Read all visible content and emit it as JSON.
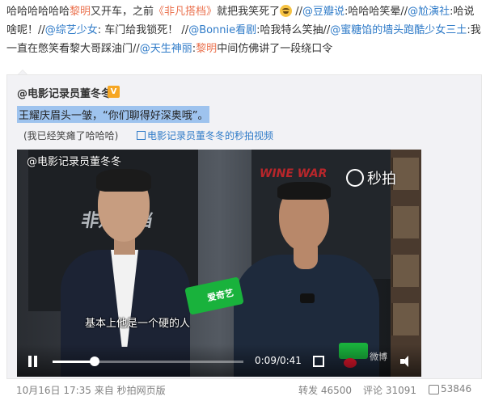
{
  "post": {
    "seg1": "哈哈哈哈哈哈",
    "name1": "黎明",
    "seg2": "又开车，之前",
    "topic": "《非凡搭档》",
    "seg3": "就把我笑死了",
    "emoji_icon": "laughing-face-icon",
    "sep1": " //",
    "at1": "@豆瓣说",
    "seg4": ":哈哈哈笑晕//",
    "at2": "@尬演社",
    "seg5": ":哈说啥呢！//",
    "at3": "@综艺少女",
    "seg6": ": 车门给我锁死！ //",
    "at4": "@Bonnie看剧",
    "seg7": ":哈我特么笑抽//",
    "at5": "@蜜糖馅的墙头跑酷少女三土",
    "seg8": ":我一直在憋笑看黎大哥踩油门//",
    "at6": "@天生神丽",
    "seg9": ":",
    "name2": "黎明",
    "seg10": "中间仿佛讲了一段绕口令"
  },
  "repost": {
    "author": "@电影记录员董冬冬",
    "badge": "V",
    "quote": "王耀庆眉头一皱，“你们聊得好深奥哦”。",
    "note": "(我已经笑瘫了哈哈哈)",
    "video_link": "电影记录员董冬冬的秒拍视频"
  },
  "video": {
    "watermark": "@电影记录员董冬冬",
    "miaopai": "秒拍",
    "poster1_text": "非凡搭档",
    "poster2_text": "WINE WAR",
    "mic_label": "爱奇艺",
    "subtitle": "基本上他是一个硬的人",
    "corner_label": "微博",
    "time": "0:09/0:41",
    "progress": 0.22
  },
  "footer": {
    "date": "10月16日 17:35",
    "source": "来自 秒拍网页版",
    "repost": "转发 46500",
    "comment": "评论 31091",
    "likes": "53846"
  },
  "colors": {
    "link": "#eb7350",
    "at": "#2f7bc8",
    "quote_highlight": "#9ec3ee"
  }
}
